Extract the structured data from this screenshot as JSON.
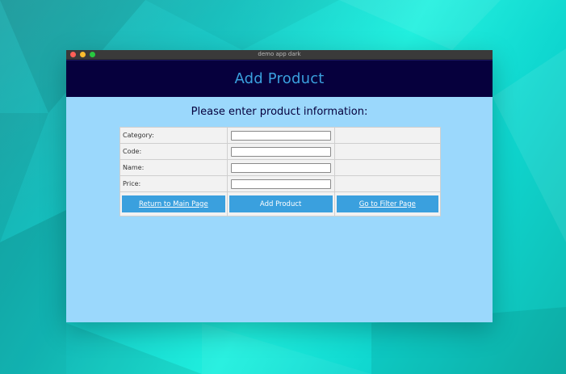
{
  "window": {
    "title": "demo app dark"
  },
  "header": {
    "title": "Add Product"
  },
  "form": {
    "heading": "Please enter product information:",
    "fields": [
      {
        "label": "Category:",
        "value": ""
      },
      {
        "label": "Code:",
        "value": ""
      },
      {
        "label": "Name:",
        "value": ""
      },
      {
        "label": "Price:",
        "value": ""
      }
    ],
    "buttons": {
      "return": "Return to Main Page",
      "add": "Add Product",
      "filter": "Go to Filter Page"
    }
  },
  "colors": {
    "header_bg": "#06003d",
    "accent": "#3aa0de",
    "content_bg": "#9bd8fc"
  }
}
